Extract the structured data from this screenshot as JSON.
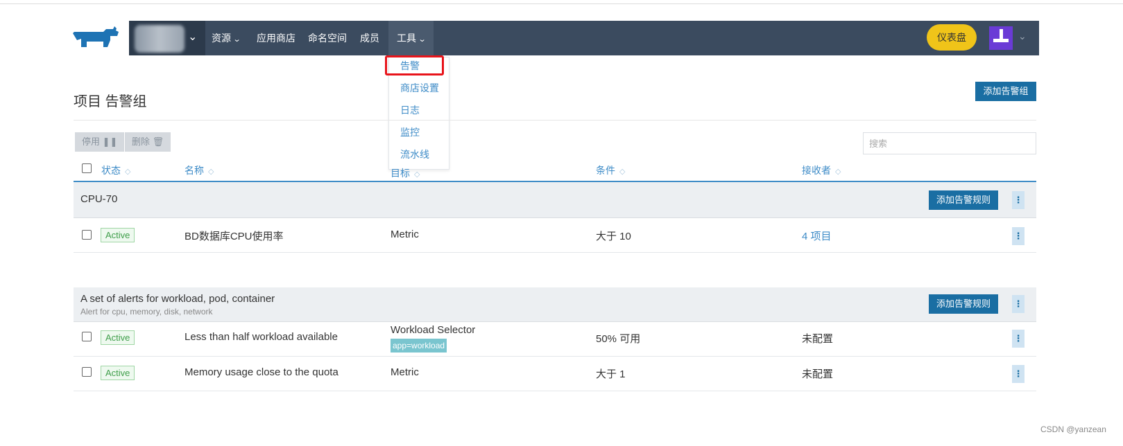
{
  "nav": {
    "items": [
      {
        "label": "资源",
        "has_caret": true
      },
      {
        "label": "应用商店"
      },
      {
        "label": "命名空间"
      },
      {
        "label": "成员"
      },
      {
        "label": "工具",
        "has_caret": true
      }
    ],
    "dashboard_label": "仪表盘"
  },
  "tools_menu": {
    "items": [
      "告警",
      "商店设置",
      "日志",
      "监控",
      "流水线"
    ],
    "highlighted": "告警"
  },
  "page": {
    "title": "项目 告警组",
    "add_group_label": "添加告警组"
  },
  "toolbar": {
    "disable_label": "停用 ❚❚",
    "delete_label": "删除 🗑",
    "search_placeholder": "搜索"
  },
  "columns": [
    "状态",
    "名称",
    "目标",
    "条件",
    "接收者"
  ],
  "add_rule_label": "添加告警规则",
  "groups": [
    {
      "title": "CPU-70",
      "subtitle": "",
      "rules": [
        {
          "state": "Active",
          "name": "BD数据库CPU使用率",
          "target": "Metric",
          "target_tag": "",
          "condition": "大于 10",
          "recipients": "4 项目"
        }
      ]
    },
    {
      "title": "A set of alerts for workload, pod, container",
      "subtitle": "Alert for cpu, memory, disk, network",
      "rules": [
        {
          "state": "Active",
          "name": "Less than half workload available",
          "target": "Workload Selector",
          "target_tag": "app=workload",
          "condition": "50% 可用",
          "recipients": "未配置"
        },
        {
          "state": "Active",
          "name": "Memory usage close to the quota",
          "target": "Metric",
          "target_tag": "",
          "condition": "大于 1",
          "recipients": "未配置"
        }
      ]
    }
  ],
  "watermark": "CSDN @yanzean",
  "colors": {
    "navbar": "#3b4b5f",
    "primary": "#1a6ea3",
    "link": "#3d8bc7",
    "dashboard": "#f0c419",
    "highlight": "#e8141b",
    "active_badge": "#3f9e4a"
  }
}
